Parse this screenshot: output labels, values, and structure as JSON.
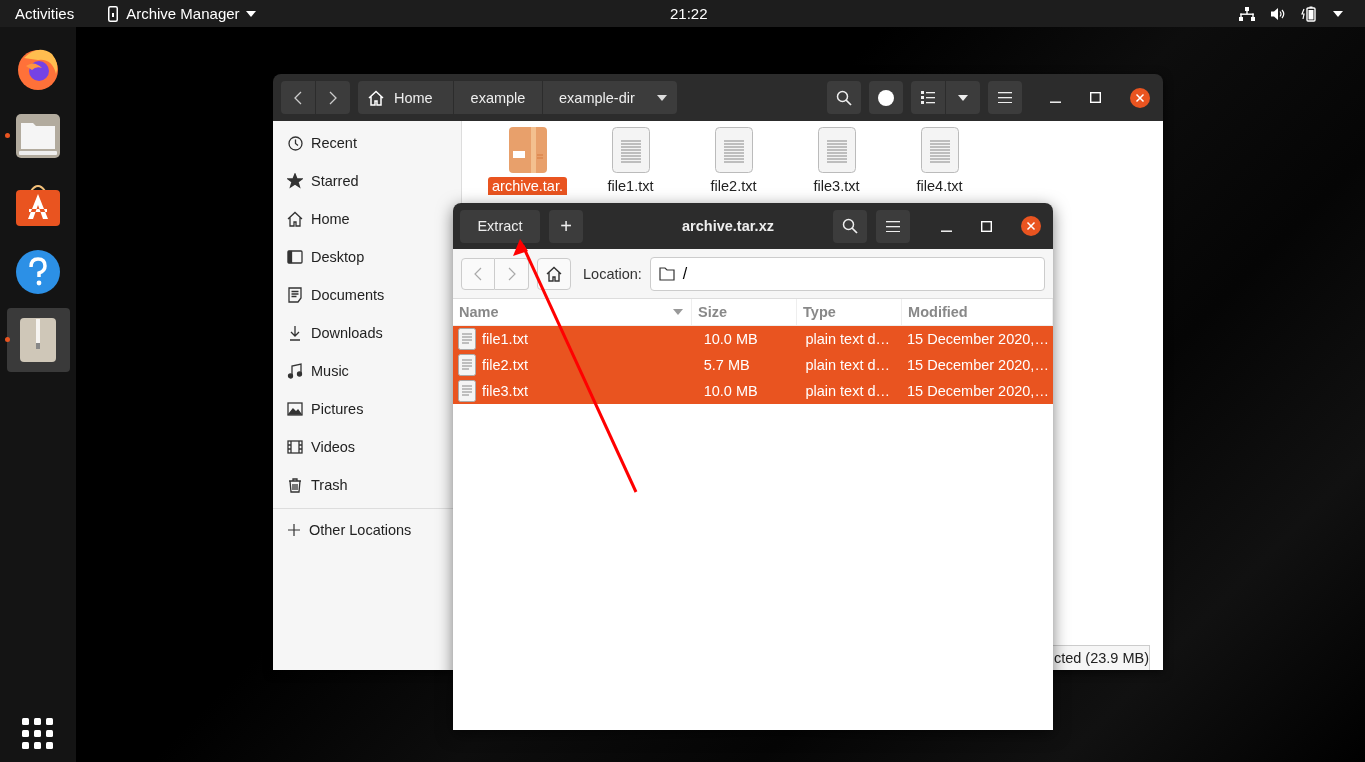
{
  "top_bar": {
    "activities": "Activities",
    "app_menu": "Archive Manager",
    "clock": "21:22"
  },
  "dock": [
    {
      "kind": "firefox",
      "running": false,
      "selected": false
    },
    {
      "kind": "files",
      "running": true,
      "selected": false
    },
    {
      "kind": "software",
      "running": false,
      "selected": false
    },
    {
      "kind": "help",
      "running": false,
      "selected": false
    },
    {
      "kind": "archive",
      "running": true,
      "selected": true
    }
  ],
  "files_window": {
    "path": [
      {
        "label": "Home",
        "kind": "home"
      },
      {
        "label": "example",
        "kind": "folder"
      },
      {
        "label": "example-dir",
        "kind": "current"
      }
    ],
    "sidebar": [
      {
        "kind": "recent",
        "label": "Recent",
        "selected": false
      },
      {
        "kind": "starred",
        "label": "Starred",
        "selected": false
      },
      {
        "kind": "home",
        "label": "Home",
        "selected": false
      },
      {
        "kind": "desktop",
        "label": "Desktop",
        "selected": false
      },
      {
        "kind": "documents",
        "label": "Documents",
        "selected": false
      },
      {
        "kind": "downloads",
        "label": "Downloads",
        "selected": false
      },
      {
        "kind": "music",
        "label": "Music",
        "selected": false
      },
      {
        "kind": "pictures",
        "label": "Pictures",
        "selected": false
      },
      {
        "kind": "videos",
        "label": "Videos",
        "selected": false
      },
      {
        "kind": "trash",
        "label": "Trash",
        "selected": false
      }
    ],
    "other_locations": "Other Locations",
    "files": [
      {
        "kind": "archive",
        "name": "archive.tar.",
        "selected": true
      },
      {
        "kind": "text",
        "name": "file1.txt",
        "selected": false
      },
      {
        "kind": "text",
        "name": "file2.txt",
        "selected": false
      },
      {
        "kind": "text",
        "name": "file3.txt",
        "selected": false
      },
      {
        "kind": "text",
        "name": "file4.txt",
        "selected": false
      }
    ],
    "status": "cted (23.9 MB)"
  },
  "archive_window": {
    "title": "archive.tar.xz",
    "extract": "Extract",
    "add": "+",
    "location_label": "Location:",
    "location": "/",
    "columns": [
      "Name",
      "Size",
      "Type",
      "Modified"
    ],
    "rows": [
      {
        "name": "file1.txt",
        "size": "10.0 MB",
        "type": "plain text d…",
        "modified": "15 December 2020,…",
        "selected": true
      },
      {
        "name": "file2.txt",
        "size": "5.7 MB",
        "type": "plain text d…",
        "modified": "15 December 2020,…",
        "selected": true
      },
      {
        "name": "file3.txt",
        "size": "10.0 MB",
        "type": "plain text d…",
        "modified": "15 December 2020,…",
        "selected": true
      }
    ]
  }
}
